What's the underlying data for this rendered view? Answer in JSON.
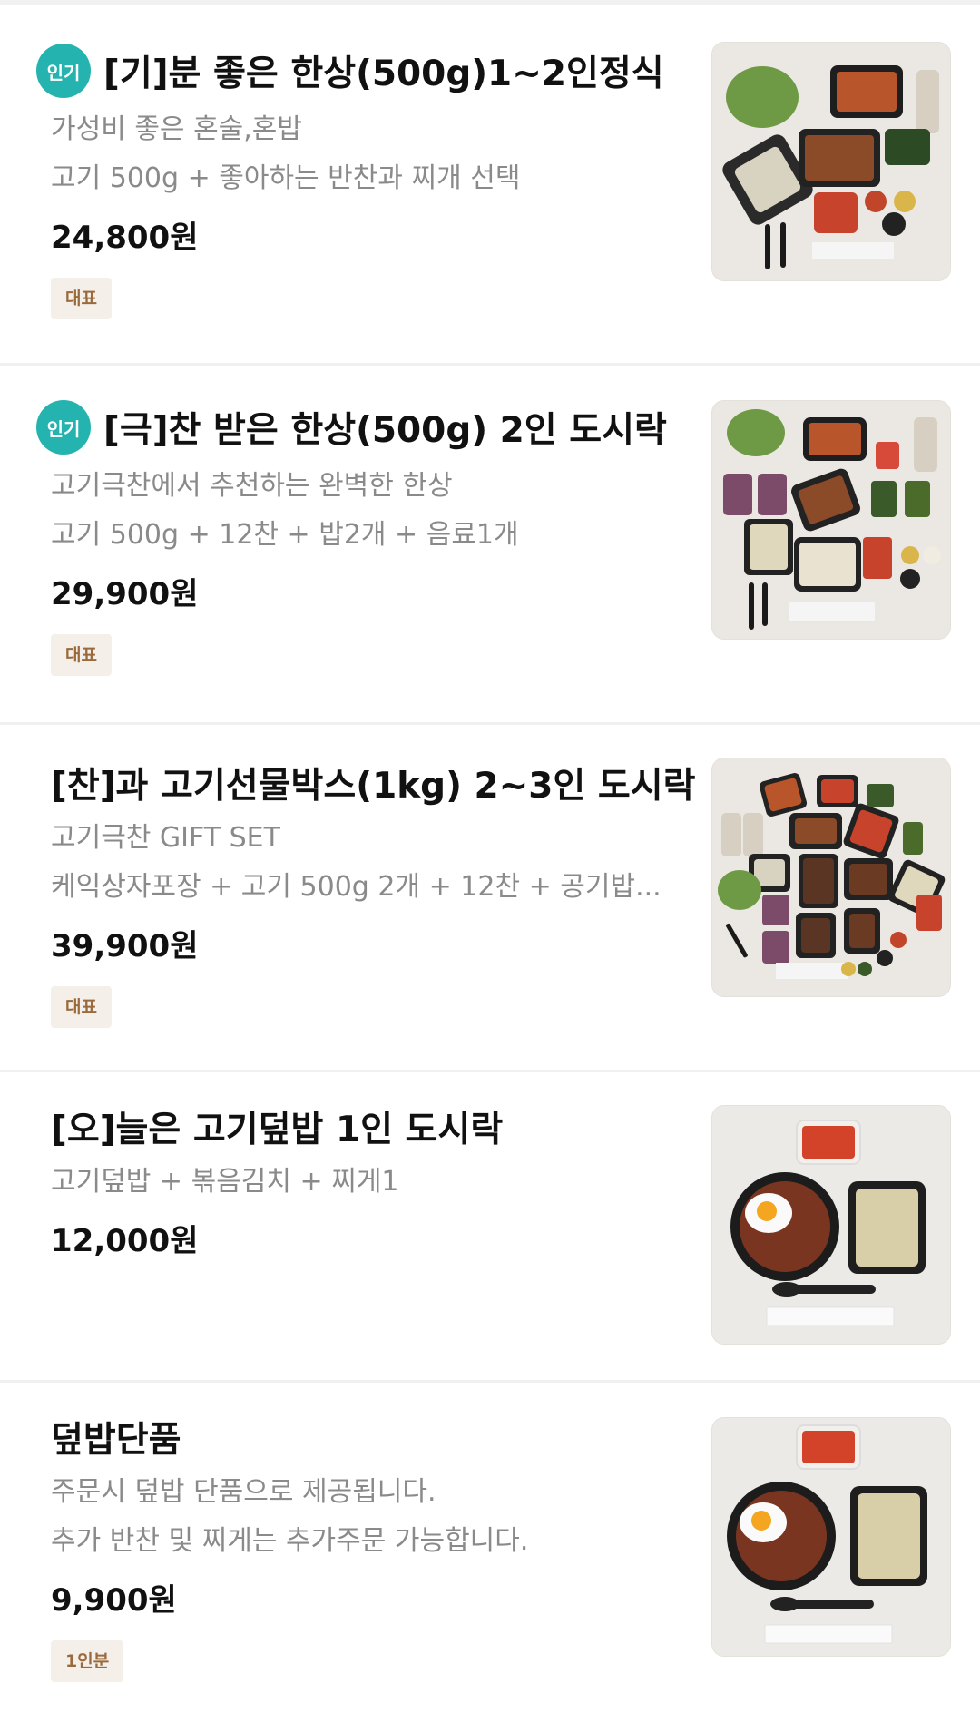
{
  "menu": {
    "popular_label": "인기",
    "items": [
      {
        "name": "[기]분 좋은 한상(500g)1~2인정식",
        "desc1": "가성비 좋은 혼술,혼밥",
        "desc2": "고기 500g + 좋아하는 반찬과 찌개 선택",
        "price": "24,800원",
        "tag": "대표",
        "popular": true,
        "image": "meal-set-photo"
      },
      {
        "name": "[극]찬 받은 한상(500g)  2인 도시락",
        "desc1": "고기극찬에서 추천하는 완벽한 한상",
        "desc2": "고기 500g + 12찬 + 밥2개 + 음료1개",
        "price": "29,900원",
        "tag": "대표",
        "popular": true,
        "image": "lunchbox-set-photo"
      },
      {
        "name": "[찬]과 고기선물박스(1kg) 2~3인 도시락",
        "desc1": "고기극찬 GIFT SET",
        "desc2": "케익상자포장 + 고기 500g 2개 + 12찬 + 공기밥...",
        "price": "39,900원",
        "tag": "대표",
        "popular": false,
        "image": "gift-box-photo"
      },
      {
        "name": "[오]늘은 고기덮밥 1인 도시락",
        "desc1": "고기덮밥 + 볶음김치 + 찌게1",
        "price": "12,000원",
        "popular": false,
        "image": "rice-bowl-photo"
      },
      {
        "name": "덮밥단품",
        "desc1": "주문시 덮밥 단품으로 제공됩니다.",
        "desc2": "추가 반찬 및 찌게는 추가주문 가능합니다.",
        "price": "9,900원",
        "tag": "1인분",
        "popular": false,
        "image": "rice-bowl-single-photo"
      }
    ]
  }
}
